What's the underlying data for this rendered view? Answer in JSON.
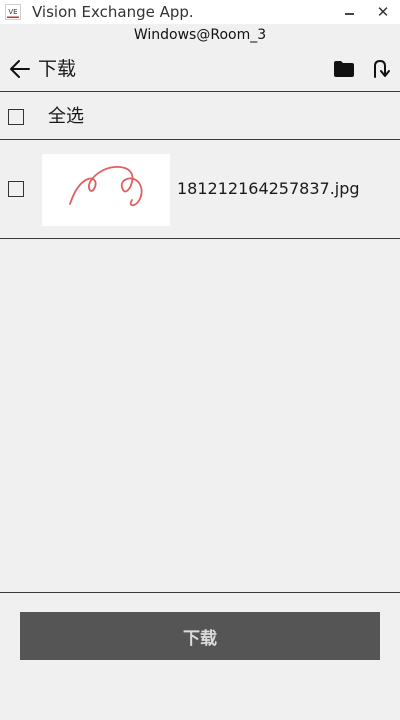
{
  "window": {
    "logo_text": "VE",
    "title": "Vision Exchange App.",
    "minimize_symbol": "",
    "close_symbol": "✕"
  },
  "room": {
    "label": "Windows@Room_3"
  },
  "header": {
    "title": "下载",
    "back_icon": "back-arrow-icon",
    "folder_icon": "folder-icon",
    "refresh_icon": "refresh-icon"
  },
  "select_all": {
    "label": "全选",
    "checked": false
  },
  "files": [
    {
      "name": "181212164257837.jpg",
      "checked": false,
      "thumbnail": "handwriting-sketch-thumbnail"
    }
  ],
  "footer": {
    "download_label": "下载"
  },
  "colors": {
    "background": "#f0f0f0",
    "titlebar": "#ffffff",
    "button": "#555555",
    "button_text": "#dcdcdc",
    "sketch_stroke": "#e06060",
    "logo_accent": "#c0392b"
  }
}
